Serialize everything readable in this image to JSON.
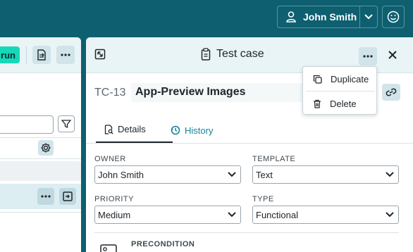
{
  "topbar": {
    "user_name": "John Smith"
  },
  "left_panel": {
    "run_label": "run"
  },
  "test_case": {
    "panel_title": "Test case",
    "id": "TC-13",
    "name": "App-Preview Images",
    "tabs": [
      {
        "label": "Details",
        "active": true
      },
      {
        "label": "History",
        "active": false
      }
    ],
    "fields": {
      "owner": {
        "label": "OWNER",
        "value": "John Smith"
      },
      "template": {
        "label": "TEMPLATE",
        "value": "Text"
      },
      "priority": {
        "label": "PRIORITY",
        "value": "Medium"
      },
      "type": {
        "label": "TYPE",
        "value": "Functional"
      }
    },
    "precondition_label": "PRECONDITION"
  },
  "more_menu": {
    "items": [
      {
        "label": "Duplicate",
        "icon": "copy-icon"
      },
      {
        "label": "Delete",
        "icon": "trash-icon"
      }
    ]
  },
  "colors": {
    "topbar": "#0e5f70",
    "accent": "#14849a",
    "run_button": "#14d8b8",
    "panel_header": "#e9f4f6",
    "icon_button": "#d1e4e9"
  }
}
